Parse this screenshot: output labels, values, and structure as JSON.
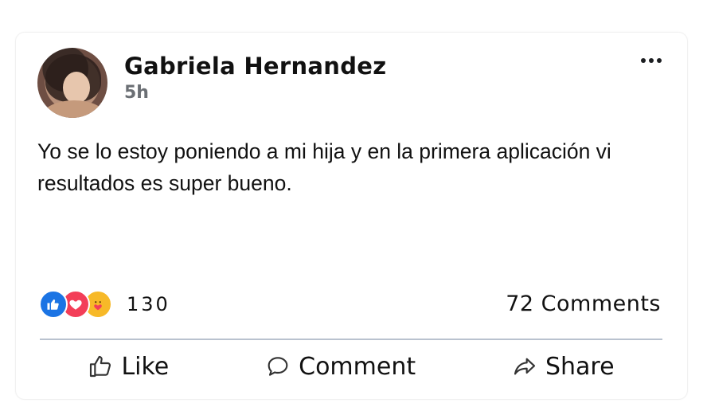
{
  "post": {
    "author": "Gabriela Hernandez",
    "time": "5h",
    "text": "Yo se lo estoy poniendo a mi hija y en la primera aplicación vi resultados es super bueno."
  },
  "reactions": {
    "count": "130",
    "icons": [
      "like-icon",
      "love-icon",
      "care-icon"
    ],
    "colors": {
      "like": "#1b74e4",
      "love": "#f33e58",
      "care": "#f7b928"
    }
  },
  "comments": {
    "label": "72 Comments"
  },
  "actions": {
    "like": "Like",
    "comment": "Comment",
    "share": "Share"
  }
}
